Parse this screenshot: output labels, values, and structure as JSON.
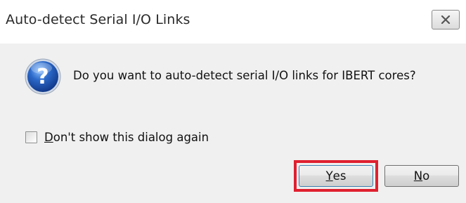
{
  "window": {
    "title": "Auto-detect Serial I/O Links",
    "close_label": "close"
  },
  "message": {
    "icon": "question-icon",
    "text": "Do you want to auto-detect serial I/O links for IBERT cores?"
  },
  "checkbox": {
    "checked": false,
    "label_mnemonic": "D",
    "label_rest": "on't show this dialog again"
  },
  "buttons": {
    "yes": {
      "mnemonic": "Y",
      "rest": "es",
      "highlighted": true
    },
    "no": {
      "mnemonic": "N",
      "rest": "o"
    }
  },
  "colors": {
    "highlight": "#e0202f",
    "icon_blue": "#2c69c9",
    "dialog_bg": "#f0f0f0"
  }
}
